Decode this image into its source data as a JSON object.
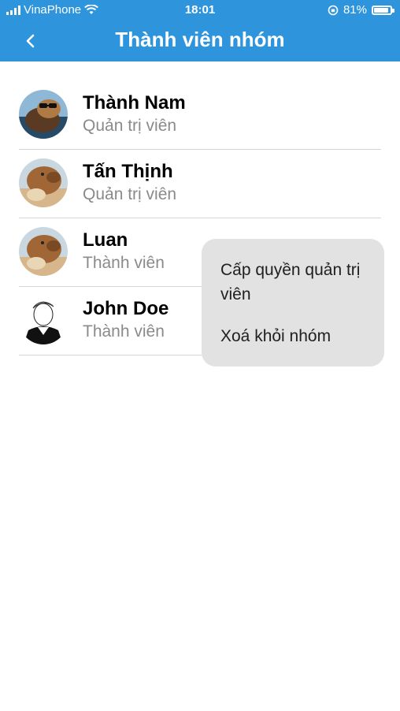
{
  "status_bar": {
    "carrier": "VinaPhone",
    "time": "18:01",
    "battery": "81%"
  },
  "header": {
    "title": "Thành viên nhóm"
  },
  "members": [
    {
      "name": "Thành Nam",
      "role": "Quản trị viên"
    },
    {
      "name": "Tấn Thịnh",
      "role": "Quản trị viên"
    },
    {
      "name": "Luan",
      "role": "Thành viên"
    },
    {
      "name": "John Doe",
      "role": "Thành viên"
    }
  ],
  "context_menu": {
    "items": [
      {
        "label": "Cấp quyền quản trị viên"
      },
      {
        "label": "Xoá khỏi nhóm"
      }
    ]
  }
}
